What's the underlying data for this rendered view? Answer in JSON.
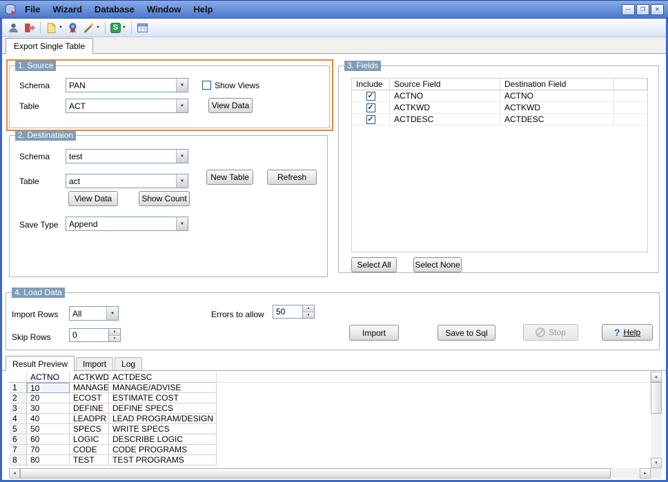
{
  "glyphs": {
    "combo_arrow": "▼",
    "spin_up": "▲",
    "spin_down": "▼",
    "check": "✓",
    "scroll_up": "▲",
    "scroll_down": "▼",
    "scroll_left": "◄",
    "scroll_right": "►",
    "minimize": "—",
    "restore": "❐",
    "close": "✕",
    "help_q": "?",
    "sql": "S"
  },
  "titlebar": {
    "menu": [
      "File",
      "Wizard",
      "Database",
      "Window",
      "Help"
    ]
  },
  "toolbar": {
    "icons": [
      "user",
      "disconnect",
      "export-file",
      "certificate",
      "wizard-wand",
      "sql-window",
      "data-grid"
    ]
  },
  "main_tab": "Export Single Table",
  "source": {
    "title": "1. Source",
    "schema_label": "Schema",
    "schema_value": "PAN",
    "show_views": "Show Views",
    "table_label": "Table",
    "table_value": "ACT",
    "view_data": "View Data"
  },
  "destination": {
    "title": "2. Destinataion",
    "schema_label": "Schema",
    "schema_value": "test",
    "table_label": "Table",
    "table_value": "act",
    "new_table": "New Table",
    "refresh": "Refresh",
    "view_data": "View Data",
    "show_count": "Show Count",
    "save_type_label": "Save Type",
    "save_type_value": "Append"
  },
  "fields": {
    "title": "3. Fields",
    "col_include": "Include",
    "col_source": "Source Field",
    "col_dest": "Destination Field",
    "rows": [
      {
        "source": "ACTNO",
        "dest": "ACTNO"
      },
      {
        "source": "ACTKWD",
        "dest": "ACTKWD"
      },
      {
        "source": "ACTDESC",
        "dest": "ACTDESC"
      }
    ],
    "select_all": "Select All",
    "select_none": "Select None"
  },
  "load": {
    "title": "4. Load Data",
    "import_rows_label": "Import Rows",
    "import_rows_value": "All",
    "errors_label": "Errors to allow",
    "errors_value": "50",
    "skip_rows_label": "Skip Rows",
    "skip_rows_value": "0",
    "import": "Import",
    "save_to_sql": "Save to Sql",
    "stop": "Stop",
    "help": "Help"
  },
  "preview": {
    "tabs": [
      "Result Preview",
      "Import",
      "Log"
    ],
    "columns": [
      "ACTNO",
      "ACTKWD",
      "ACTDESC"
    ],
    "rows": [
      [
        "1",
        "10",
        "MANAGE",
        "MANAGE/ADVISE"
      ],
      [
        "2",
        "20",
        "ECOST",
        "ESTIMATE COST"
      ],
      [
        "3",
        "30",
        "DEFINE",
        "DEFINE SPECS"
      ],
      [
        "4",
        "40",
        "LEADPR",
        "LEAD PROGRAM/DESIGN"
      ],
      [
        "5",
        "50",
        "SPECS",
        "WRITE SPECS"
      ],
      [
        "6",
        "60",
        "LOGIC",
        "DESCRIBE LOGIC"
      ],
      [
        "7",
        "70",
        "CODE",
        "CODE PROGRAMS"
      ],
      [
        "8",
        "80",
        "TEST",
        "TEST PROGRAMS"
      ]
    ]
  },
  "colors": {
    "window_frame": "#3a67c8",
    "highlight_orange": "#e0883a",
    "group_title_bg": "#7f9db9",
    "grid_line_pink": "#e8c7c7"
  }
}
